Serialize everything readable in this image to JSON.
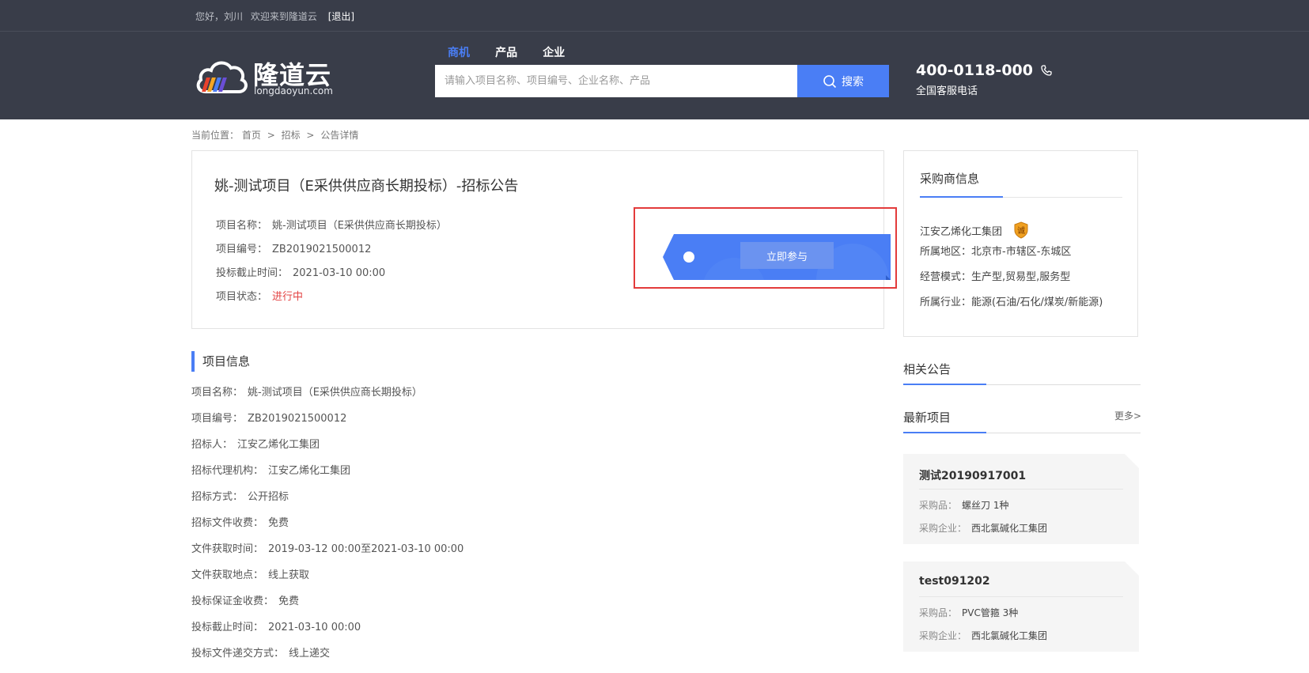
{
  "topbar": {
    "greeting": "您好，刘川",
    "welcome": "欢迎来到隆道云",
    "logout": "[退出]"
  },
  "header": {
    "logo_name": "隆道云",
    "logo_domain": "longdaoyun.com",
    "nav_tabs": [
      "商机",
      "产品",
      "企业"
    ],
    "active_tab": "商机",
    "search_placeholder": "请输入项目名称、项目编号、企业名称、产品",
    "search_button": "搜索",
    "phone_number": "400-0118-000",
    "phone_label": "全国客服电话"
  },
  "breadcrumb": {
    "prefix": "当前位置：",
    "items": [
      "首页",
      "招标",
      "公告详情"
    ],
    "separator": ">"
  },
  "notice": {
    "title": "姚-测试项目（E采供供应商长期投标）-招标公告",
    "rows": [
      {
        "label": "项目名称：",
        "value": "姚-测试项目（E采供供应商长期投标）"
      },
      {
        "label": "项目编号：",
        "value": "ZB2019021500012"
      },
      {
        "label": "投标截止时间：",
        "value": "2021-03-10 00:00"
      },
      {
        "label": "项目状态：",
        "value": "进行中"
      }
    ],
    "join_button": "立即参与"
  },
  "project_info": {
    "heading": "项目信息",
    "rows": [
      {
        "label": "项目名称：",
        "value": "姚-测试项目（E采供供应商长期投标）"
      },
      {
        "label": "项目编号：",
        "value": "ZB2019021500012"
      },
      {
        "label": "招标人：",
        "value": "江安乙烯化工集团"
      },
      {
        "label": "招标代理机构：",
        "value": "江安乙烯化工集团"
      },
      {
        "label": "招标方式：",
        "value": "公开招标"
      },
      {
        "label": "招标文件收费：",
        "value": "免费"
      },
      {
        "label": "文件获取时间：",
        "value": "2019-03-12 00:00至2021-03-10 00:00"
      },
      {
        "label": "文件获取地点：",
        "value": "线上获取"
      },
      {
        "label": "投标保证金收费：",
        "value": "免费"
      },
      {
        "label": "投标截止时间：",
        "value": "2021-03-10 00:00"
      },
      {
        "label": "投标文件递交方式：",
        "value": "线上递交"
      }
    ]
  },
  "buyer": {
    "heading": "采购商信息",
    "company": "江安乙烯化工集团",
    "badge_text": "诚",
    "rows": [
      {
        "label": "所属地区：",
        "value": "北京市-市辖区-东城区"
      },
      {
        "label": "经营模式：",
        "value": "生产型,贸易型,服务型"
      },
      {
        "label": "所属行业：",
        "value": "能源(石油/石化/煤炭/新能源)"
      }
    ]
  },
  "related": {
    "heading": "相关公告"
  },
  "latest": {
    "heading": "最新项目",
    "more": "更多>",
    "projects": [
      {
        "title": "测试20190917001",
        "item_label": "采购品：",
        "item_value": "螺丝刀 1种",
        "company_label": "采购企业：",
        "company_value": "西北氯碱化工集团"
      },
      {
        "title": "test091202",
        "item_label": "采购品：",
        "item_value": "PVC管箍 3种",
        "company_label": "采购企业：",
        "company_value": "西北氯碱化工集团"
      }
    ]
  },
  "colors": {
    "header_bg": "#393d49",
    "accent": "#4a7ef5",
    "status_red": "#e34343",
    "highlight_red": "#e33b3b"
  }
}
